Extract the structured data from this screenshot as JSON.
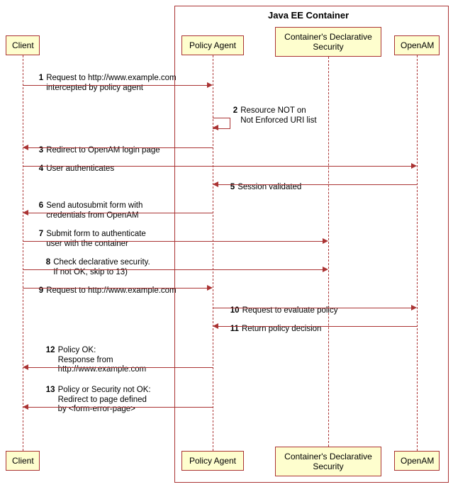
{
  "container": {
    "title": "Java EE Container"
  },
  "participants": {
    "client": "Client",
    "policy_agent": "Policy Agent",
    "declarative": "Container's\nDeclarative Security",
    "openam": "OpenAM"
  },
  "messages": {
    "m1": {
      "num": "1",
      "text": "Request to http://www.example.com\nintercepted by policy agent"
    },
    "m2": {
      "num": "2",
      "text": "Resource NOT on\nNot Enforced URI list"
    },
    "m3": {
      "num": "3",
      "text": "Redirect to OpenAM login page"
    },
    "m4": {
      "num": "4",
      "text": "User authenticates"
    },
    "m5": {
      "num": "5",
      "text": "Session validated"
    },
    "m6": {
      "num": "6",
      "text": "Send autosubmit form with\ncredentials from OpenAM"
    },
    "m7": {
      "num": "7",
      "text": "Submit form to authenticate\nuser with the container"
    },
    "m8": {
      "num": "8",
      "text": "Check declarative security.\nIf not OK, skip to 13)"
    },
    "m9": {
      "num": "9",
      "text": "Request to http://www.example.com"
    },
    "m10": {
      "num": "10",
      "text": "Request to evaluate policy"
    },
    "m11": {
      "num": "11",
      "text": "Return policy decision"
    },
    "m12": {
      "num": "12",
      "text": "Policy OK:\nResponse from\nhttp://www.example.com"
    },
    "m13": {
      "num": "13",
      "text": "Policy or Security not OK:\nRedirect to page defined\nby <form-error-page>"
    }
  },
  "chart_data": {
    "type": "sequence_diagram",
    "container": {
      "name": "Java EE Container",
      "participants": [
        "Policy Agent",
        "Container's Declarative Security",
        "OpenAM"
      ]
    },
    "participants": [
      "Client",
      "Policy Agent",
      "Container's Declarative Security",
      "OpenAM"
    ],
    "messages": [
      {
        "n": 1,
        "from": "Client",
        "to": "Policy Agent",
        "text": "Request to http://www.example.com intercepted by policy agent"
      },
      {
        "n": 2,
        "from": "Policy Agent",
        "to": "Policy Agent",
        "text": "Resource NOT on Not Enforced URI list"
      },
      {
        "n": 3,
        "from": "Policy Agent",
        "to": "Client",
        "text": "Redirect to OpenAM login page"
      },
      {
        "n": 4,
        "from": "Client",
        "to": "OpenAM",
        "text": "User authenticates"
      },
      {
        "n": 5,
        "from": "OpenAM",
        "to": "Policy Agent",
        "text": "Session validated"
      },
      {
        "n": 6,
        "from": "Policy Agent",
        "to": "Client",
        "text": "Send autosubmit form with credentials from OpenAM"
      },
      {
        "n": 7,
        "from": "Client",
        "to": "Container's Declarative Security",
        "text": "Submit form to authenticate user with the container"
      },
      {
        "n": 8,
        "from": "Client",
        "to": "Container's Declarative Security",
        "text": "Check declarative security. If not OK, skip to 13)"
      },
      {
        "n": 9,
        "from": "Client",
        "to": "Policy Agent",
        "text": "Request to http://www.example.com"
      },
      {
        "n": 10,
        "from": "Policy Agent",
        "to": "OpenAM",
        "text": "Request to evaluate policy"
      },
      {
        "n": 11,
        "from": "OpenAM",
        "to": "Policy Agent",
        "text": "Return policy decision"
      },
      {
        "n": 12,
        "from": "Policy Agent",
        "to": "Client",
        "text": "Policy OK: Response from http://www.example.com"
      },
      {
        "n": 13,
        "from": "Policy Agent",
        "to": "Client",
        "text": "Policy or Security not OK: Redirect to page defined by <form-error-page>"
      }
    ]
  }
}
